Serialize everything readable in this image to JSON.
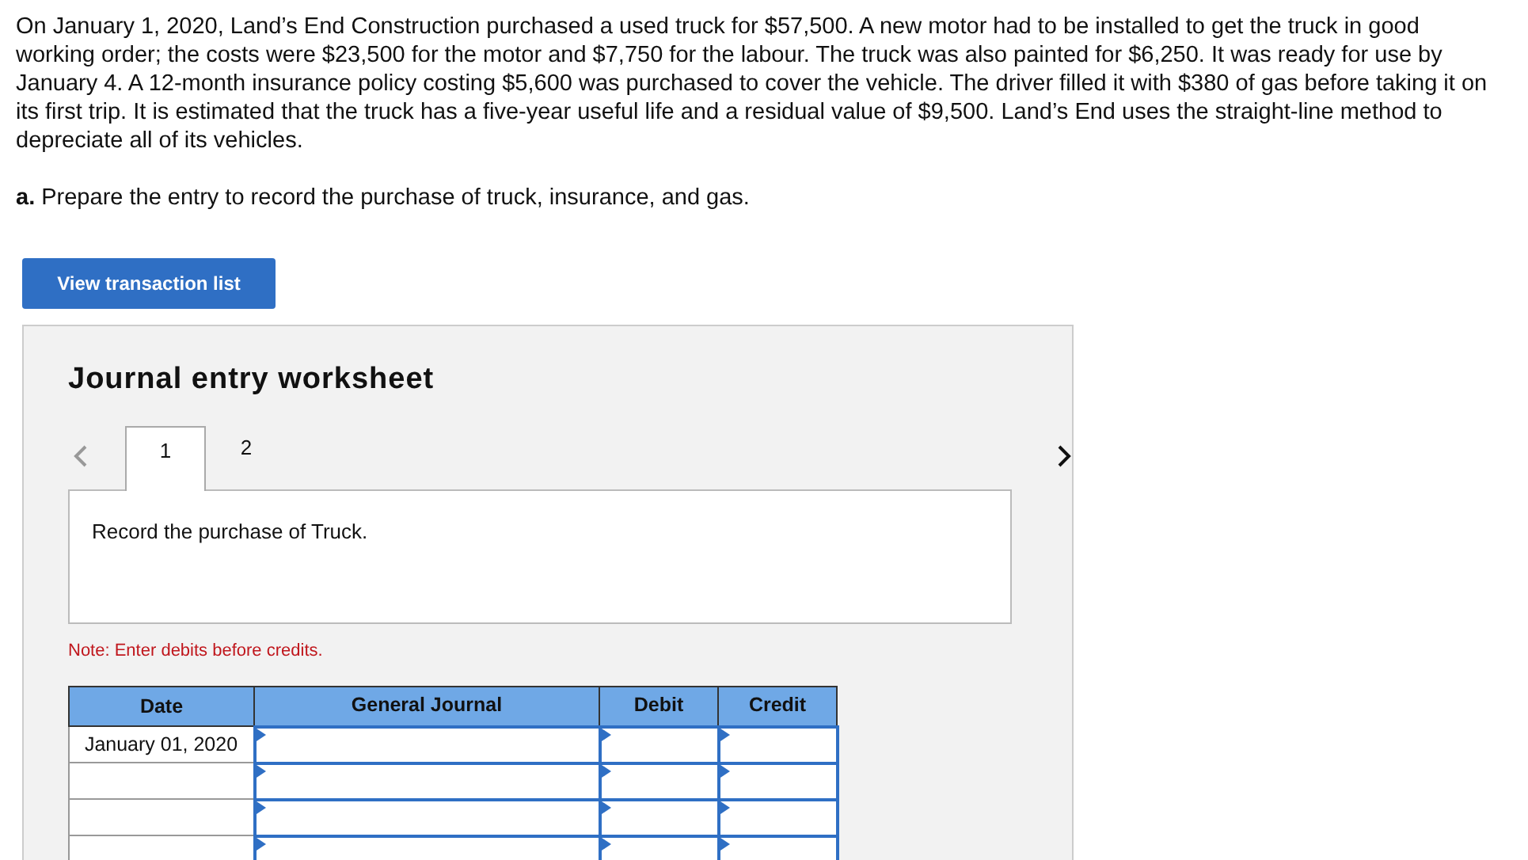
{
  "problem_text": "On January 1, 2020, Land’s End Construction purchased a used truck for $57,500. A new motor had to be installed to get the truck in good working order; the costs were $23,500 for the motor and $7,750 for the labour. The truck was also painted for $6,250. It was ready for use by January 4. A 12-month insurance policy costing $5,600 was purchased to cover the vehicle. The driver filled it with $380 of gas before taking it on its first trip. It is estimated that the truck has a five-year useful life and a residual value of $9,500. Land’s End uses the straight-line method to depreciate all of its vehicles.",
  "question": "**a.** Prepare the entry to record the purchase of truck, insurance, and gas.",
  "view_button": "View transaction list",
  "worksheet": {
    "title": "Journal entry worksheet",
    "tabs": [
      {
        "label": "1",
        "selected": true
      },
      {
        "label": "2",
        "selected": false
      }
    ],
    "instruction": "Record the purchase of Truck.",
    "note": "Note: Enter debits before credits.",
    "table": {
      "columns": [
        "Date",
        "General Journal",
        "Debit",
        "Credit"
      ],
      "rows": [
        {
          "date": "January 01, 2020"
        },
        {},
        {},
        {}
      ]
    }
  }
}
